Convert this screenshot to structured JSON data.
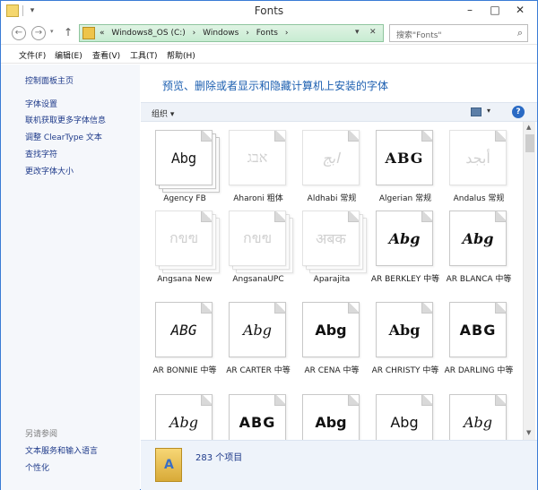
{
  "window": {
    "title": "Fonts"
  },
  "address": {
    "chevron": "«",
    "path": [
      "Windows8_OS (C:)",
      "Windows",
      "Fonts"
    ]
  },
  "search": {
    "placeholder": "搜索\"Fonts\""
  },
  "menu": {
    "items": [
      "文件(F)",
      "编辑(E)",
      "查看(V)",
      "工具(T)",
      "帮助(H)"
    ]
  },
  "left_pane": {
    "home": "控制面板主页",
    "links": [
      "字体设置",
      "联机获取更多字体信息",
      "调整 ClearType 文本",
      "查找字符",
      "更改字体大小"
    ],
    "see_also_title": "另请参阅",
    "see_also": [
      "文本服务和输入语言",
      "个性化"
    ]
  },
  "main": {
    "headline": "预览、删除或者显示和隐藏计算机上安装的字体",
    "organize_label": "组织 ▾"
  },
  "fonts": [
    {
      "name": "Agency FB",
      "sample": "Abg",
      "stack": true,
      "faded": false
    },
    {
      "name": "Aharoni 粗体",
      "sample": "אבג",
      "stack": false,
      "faded": true
    },
    {
      "name": "Aldhabi 常规",
      "sample": "ابج",
      "stack": false,
      "faded": true
    },
    {
      "name": "Algerian 常规",
      "sample": "ABG",
      "stack": false,
      "faded": false
    },
    {
      "name": "Andalus 常规",
      "sample": "أبجد",
      "stack": false,
      "faded": true
    },
    {
      "name": "Angsana New",
      "sample": "กขฃ",
      "stack": true,
      "faded": true
    },
    {
      "name": "AngsanaUPC",
      "sample": "กขฃ",
      "stack": true,
      "faded": true
    },
    {
      "name": "Aparajita",
      "sample": "अबक",
      "stack": true,
      "faded": true
    },
    {
      "name": "AR BERKLEY 中等",
      "sample": "Abg",
      "stack": false,
      "faded": false
    },
    {
      "name": "AR BLANCA 中等",
      "sample": "Abg",
      "stack": false,
      "faded": false
    },
    {
      "name": "AR BONNIE 中等",
      "sample": "ABG",
      "stack": false,
      "faded": false
    },
    {
      "name": "AR CARTER 中等",
      "sample": "Abg",
      "stack": false,
      "faded": false
    },
    {
      "name": "AR CENA 中等",
      "sample": "Abg",
      "stack": false,
      "faded": false
    },
    {
      "name": "AR CHRISTY 中等",
      "sample": "Abg",
      "stack": false,
      "faded": false
    },
    {
      "name": "AR DARLING 中等",
      "sample": "ABG",
      "stack": false,
      "faded": false
    },
    {
      "name": "",
      "sample": "Abg",
      "stack": false,
      "faded": false
    },
    {
      "name": "",
      "sample": "ABG",
      "stack": false,
      "faded": false
    },
    {
      "name": "",
      "sample": "Abg",
      "stack": false,
      "faded": false
    },
    {
      "name": "",
      "sample": "Abg",
      "stack": false,
      "faded": false
    },
    {
      "name": "",
      "sample": "Abg",
      "stack": false,
      "faded": false
    }
  ],
  "details": {
    "count_text": "283 个项目"
  }
}
